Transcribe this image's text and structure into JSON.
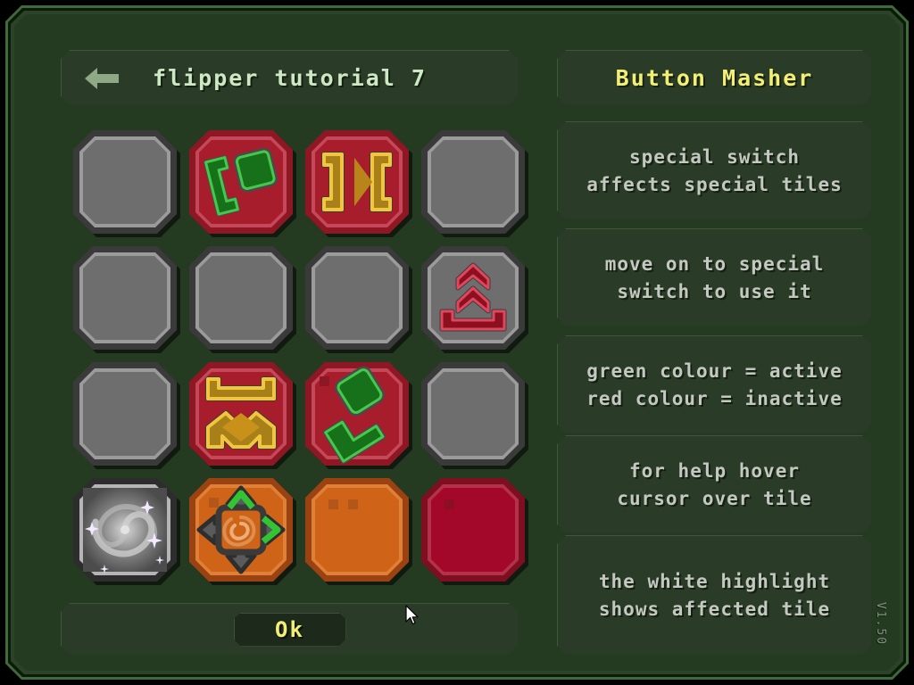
{
  "window": {
    "version_label": "V1.50"
  },
  "header": {
    "back_icon": "back-arrow-icon",
    "title": "flipper tutorial 7"
  },
  "sub_header": {
    "title": "Button Masher",
    "color": "#f2ef74"
  },
  "footer": {
    "ok_label": "Ok"
  },
  "colors": {
    "background": "#243b21",
    "frame": "#3f6b3a",
    "panel": "#2a3c27",
    "title_text": "#cde8c3",
    "accent_yellow": "#f2ef74",
    "body_text": "#c3c9c0",
    "tile_grey": "#6e6e6e",
    "tile_red": "#a81d2c",
    "tile_orange": "#cf6317",
    "tile_darkred": "#a3082a",
    "active_green": "#1f8a1f",
    "inactive_red": "#b01c2e",
    "switch_yellow": "#c9911a"
  },
  "instructions": [
    {
      "line1": "special switch",
      "line2": "affects special tiles"
    },
    {
      "line1": "move on to special",
      "line2": "switch to use it"
    },
    {
      "line1": "green colour = active",
      "line2": "red colour = inactive"
    },
    {
      "line1": "for help hover",
      "line2": "cursor over tile"
    },
    {
      "line1": "the white highlight",
      "line2": "shows affected tile"
    }
  ],
  "grid": {
    "rows": 4,
    "cols": 4,
    "tiles": [
      {
        "name": "tile-r1c1",
        "type": "grey",
        "glyph": "none"
      },
      {
        "name": "tile-r1c2",
        "type": "red",
        "glyph": "green-bracket-square"
      },
      {
        "name": "tile-r1c3",
        "type": "red",
        "glyph": "yellow-brackets"
      },
      {
        "name": "tile-r1c4",
        "type": "grey",
        "glyph": "none"
      },
      {
        "name": "tile-r2c1",
        "type": "grey",
        "glyph": "none"
      },
      {
        "name": "tile-r2c2",
        "type": "grey",
        "glyph": "none"
      },
      {
        "name": "tile-r2c3",
        "type": "grey",
        "glyph": "none"
      },
      {
        "name": "tile-r2c4",
        "type": "grey",
        "glyph": "red-chevrons-bracket"
      },
      {
        "name": "tile-r3c1",
        "type": "grey",
        "glyph": "none"
      },
      {
        "name": "tile-r3c2",
        "type": "red",
        "glyph": "yellow-bracket-chevron"
      },
      {
        "name": "tile-r3c3",
        "type": "red",
        "glyph": "green-bracket-square-rot"
      },
      {
        "name": "tile-r3c4",
        "type": "grey",
        "glyph": "none"
      },
      {
        "name": "tile-r4c1",
        "type": "spiral",
        "glyph": "galaxy-spiral"
      },
      {
        "name": "tile-r4c2",
        "type": "orange",
        "glyph": "special-switch-arrows"
      },
      {
        "name": "tile-r4c3",
        "type": "orange",
        "glyph": "two-dots"
      },
      {
        "name": "tile-r4c4",
        "type": "darkred",
        "glyph": "one-dot"
      }
    ]
  }
}
